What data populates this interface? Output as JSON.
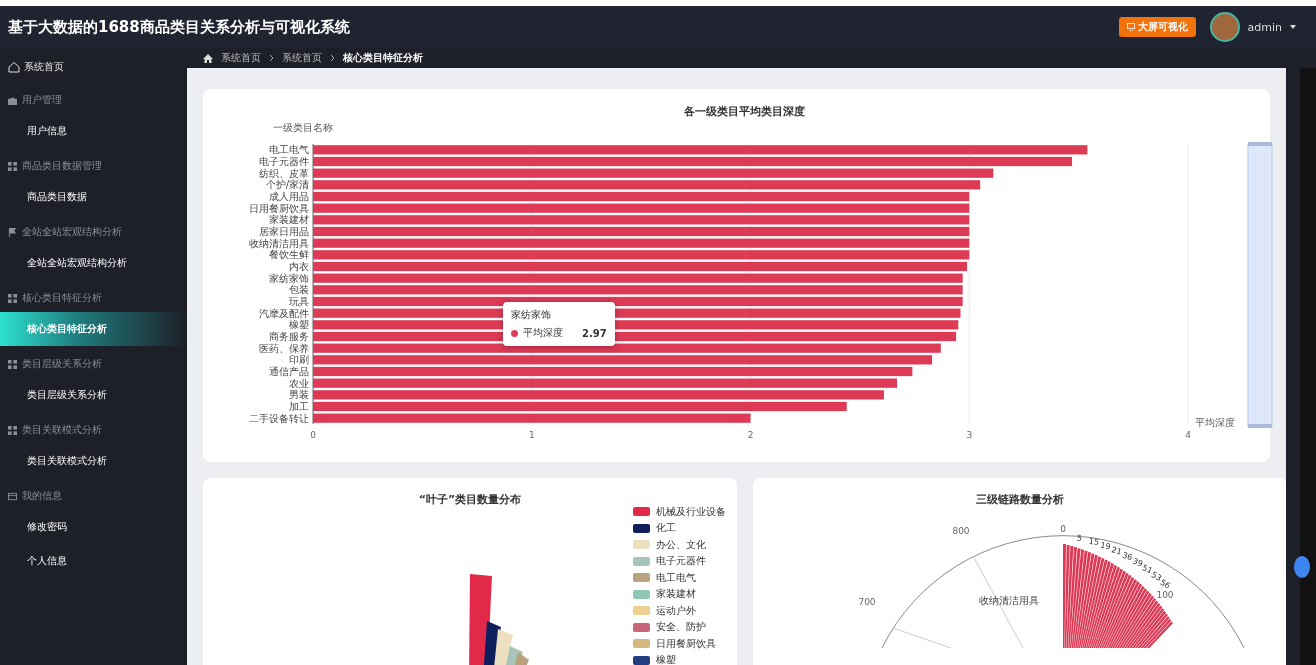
{
  "header": {
    "title": "基于大数据的1688商品类目关系分析与可视化系统",
    "screen_button": "大屏可视化",
    "user": "admin"
  },
  "sidebar": {
    "home": "系统首页",
    "groups": [
      {
        "title": "用户管理",
        "items": [
          {
            "label": "用户信息",
            "selected": false
          }
        ]
      },
      {
        "title": "商品类目数据管理",
        "items": [
          {
            "label": "商品类目数据",
            "selected": false
          }
        ]
      },
      {
        "title": "全站全站宏观结构分析",
        "items": [
          {
            "label": "全站全站宏观结构分析",
            "selected": false
          }
        ]
      },
      {
        "title": "核心类目特征分析",
        "items": [
          {
            "label": "核心类目特征分析",
            "selected": true
          }
        ]
      },
      {
        "title": "类目层级关系分析",
        "items": [
          {
            "label": "类目层级关系分析",
            "selected": false
          }
        ]
      },
      {
        "title": "类目关联模式分析",
        "items": [
          {
            "label": "类目关联模式分析",
            "selected": false
          }
        ]
      },
      {
        "title": "我的信息",
        "items": [
          {
            "label": "修改密码",
            "selected": false
          },
          {
            "label": "个人信息",
            "selected": false
          }
        ]
      }
    ]
  },
  "breadcrumb": [
    "系统首页",
    "系统首页",
    "核心类目特征分析"
  ],
  "depth_chart": {
    "tooltip": {
      "title": "家纺家饰",
      "value": "2.97"
    },
    "chart_data": {
      "type": "bar",
      "orientation": "horizontal",
      "grid": true,
      "title": "各一级类目平均类目深度",
      "ylabel": "一级类目名称",
      "xlabel": "平均深度",
      "xlim": [
        0,
        4
      ],
      "xticks": [
        0,
        1,
        2,
        3,
        4
      ],
      "categories": [
        "电工电气",
        "电子元器件",
        "纺织、皮革",
        "个护/家清",
        "成人用品",
        "日用餐厨饮具",
        "家装建材",
        "居家日用品",
        "收纳清洁用具",
        "餐饮生鲜",
        "内衣",
        "家纺家饰",
        "包装",
        "玩具",
        "汽摩及配件",
        "橡塑",
        "商务服务",
        "医药、保养",
        "印刷",
        "通信产品",
        "农业",
        "男装",
        "加工",
        "二手设备转让"
      ],
      "series": [
        {
          "name": "平均深度",
          "color": "#dc3a55",
          "values": [
            3.54,
            3.47,
            3.11,
            3.05,
            3.0,
            3.0,
            3.0,
            3.0,
            3.0,
            3.0,
            2.99,
            2.97,
            2.97,
            2.97,
            2.96,
            2.95,
            2.94,
            2.87,
            2.83,
            2.74,
            2.67,
            2.61,
            2.44,
            2.0
          ]
        }
      ]
    }
  },
  "leaf_chart": {
    "title": "“叶子”类目数量分布",
    "legend": [
      {
        "label": "机械及行业设备",
        "color": "#e3294a"
      },
      {
        "label": "化工",
        "color": "#0e1f5c"
      },
      {
        "label": "办公、文化",
        "color": "#ede0c0"
      },
      {
        "label": "电子元器件",
        "color": "#a9c4b8"
      },
      {
        "label": "电工电气",
        "color": "#b8a27f"
      },
      {
        "label": "家装建材",
        "color": "#8fc7b5"
      },
      {
        "label": "运动户外",
        "color": "#ecd08f"
      },
      {
        "label": "安全、防护",
        "color": "#c8677a"
      },
      {
        "label": "日用餐厨饮具",
        "color": "#d4b67f"
      },
      {
        "label": "橡塑",
        "color": "#223d7f"
      }
    ]
  },
  "chain_chart": {
    "title": "三级链路数量分析",
    "angle_ticks": [
      "0",
      "100",
      "700",
      "800"
    ],
    "category_label": "收纳清洁用具",
    "value_labels": [
      "5",
      "15",
      "19",
      "21",
      "36",
      "39",
      "51",
      "53",
      "56"
    ]
  }
}
